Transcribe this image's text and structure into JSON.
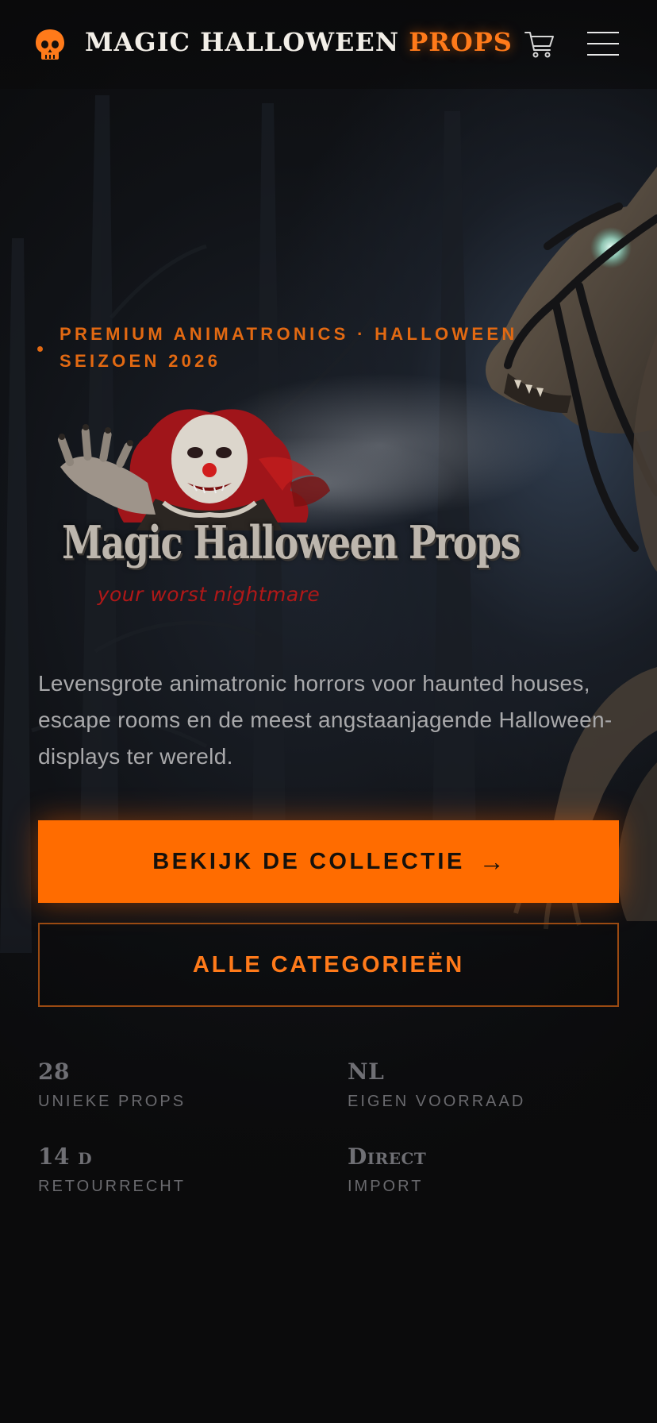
{
  "header": {
    "brand_main": "MAGIC HALLOWEEN ",
    "brand_accent": "PROPS",
    "logo_icon": "skull-icon",
    "cart_icon": "cart-icon",
    "menu_icon": "hamburger-menu-icon"
  },
  "hero": {
    "eyebrow": "PREMIUM ANIMATRONICS · HALLOWEEN SEIZOEN 2026",
    "logo_title": "Magic Halloween Props",
    "logo_tagline": "your worst nightmare",
    "description": "Levensgrote animatronic horrors voor haunted houses, escape rooms en de meest angstaanjagende Halloween-displays ter wereld.",
    "primary_cta": "BEKIJK DE COLLECTIE",
    "primary_cta_arrow": "→",
    "secondary_cta": "ALLE CATEGORIEËN"
  },
  "stats": [
    {
      "value": "28",
      "label": "UNIEKE PROPS"
    },
    {
      "value": "NL",
      "label": "EIGEN VOORRAAD"
    },
    {
      "value": "14 d",
      "label": "RETOURRECHT"
    },
    {
      "value": "Direct",
      "label": "IMPORT"
    }
  ],
  "colors": {
    "accent": "#ff6c00",
    "background": "#0b0b0c",
    "text_muted": "#a9a9ab"
  }
}
